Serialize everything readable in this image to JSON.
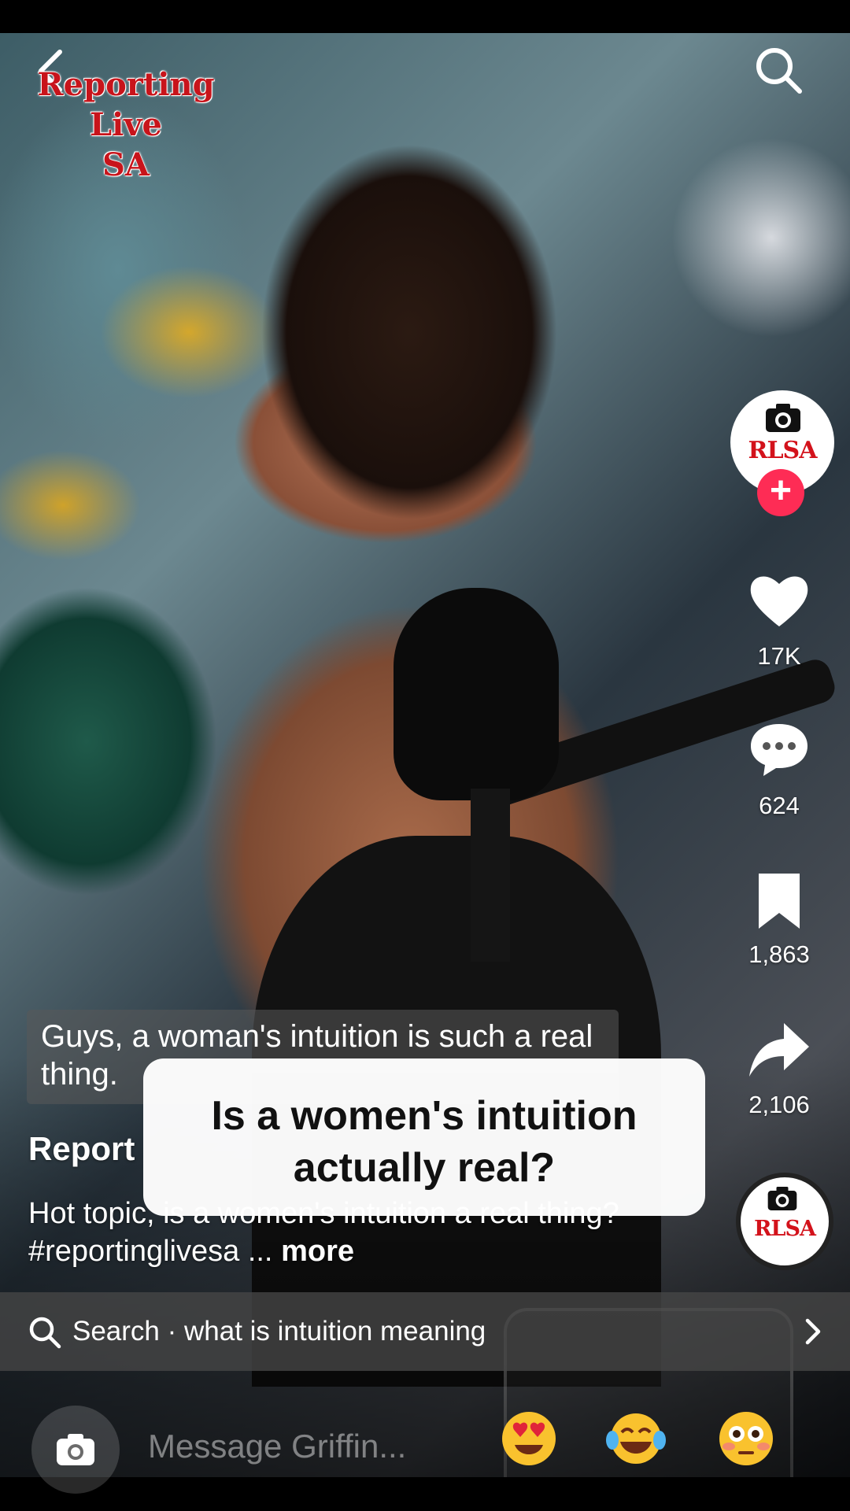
{
  "watermark": {
    "line1": "Reporting",
    "line2": "Live",
    "line3": "SA"
  },
  "profile": {
    "avatar_text": "RLSA",
    "follow_symbol": "+"
  },
  "actions": {
    "likes": "17K",
    "comments": "624",
    "saves": "1,863",
    "shares": "2,106"
  },
  "caption": {
    "text": "Guys, a woman's intuition is such a real thing."
  },
  "overlay": {
    "line1": "Is a women's intuition",
    "line2": "actually real?"
  },
  "post": {
    "author": "Report",
    "description": "Hot topic, is a women's intuition a real thing? #reportinglivesa ... ",
    "more": "more"
  },
  "search": {
    "label": "Search · what is intuition meaning"
  },
  "message": {
    "placeholder": "Message Griffin...",
    "emojis": [
      "heart-eyes-emoji",
      "tears-of-joy-emoji",
      "flushed-emoji"
    ]
  },
  "colors": {
    "brand_red": "#c8141b",
    "follow_pink": "#fe2c55"
  }
}
